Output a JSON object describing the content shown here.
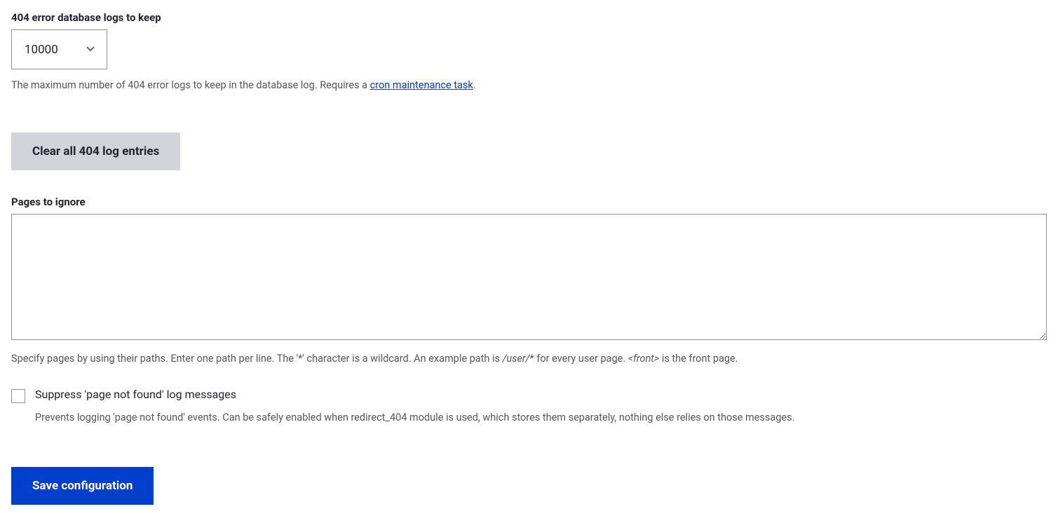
{
  "logsToKeep": {
    "label": "404 error database logs to keep",
    "value": "10000",
    "description_prefix": "The maximum number of 404 error logs to keep in the database log. Requires a ",
    "description_link": "cron maintenance task",
    "description_suffix": "."
  },
  "clearButton": {
    "label": "Clear all 404 log entries"
  },
  "pagesToIgnore": {
    "label": "Pages to ignore",
    "value": "",
    "desc_part1": "Specify pages by using their paths. Enter one path per line. The '*' character is a wildcard. An example path is ",
    "desc_em1": "/user/",
    "desc_part2": "* for every user page. ",
    "desc_em2": "<front>",
    "desc_part3": " is the front page."
  },
  "suppress": {
    "label": "Suppress 'page not found' log messages",
    "description": "Prevents logging 'page not found' events. Can be safely enabled when redirect_404 module is used, which stores them separately, nothing else relies on those messages."
  },
  "saveButton": {
    "label": "Save configuration"
  }
}
